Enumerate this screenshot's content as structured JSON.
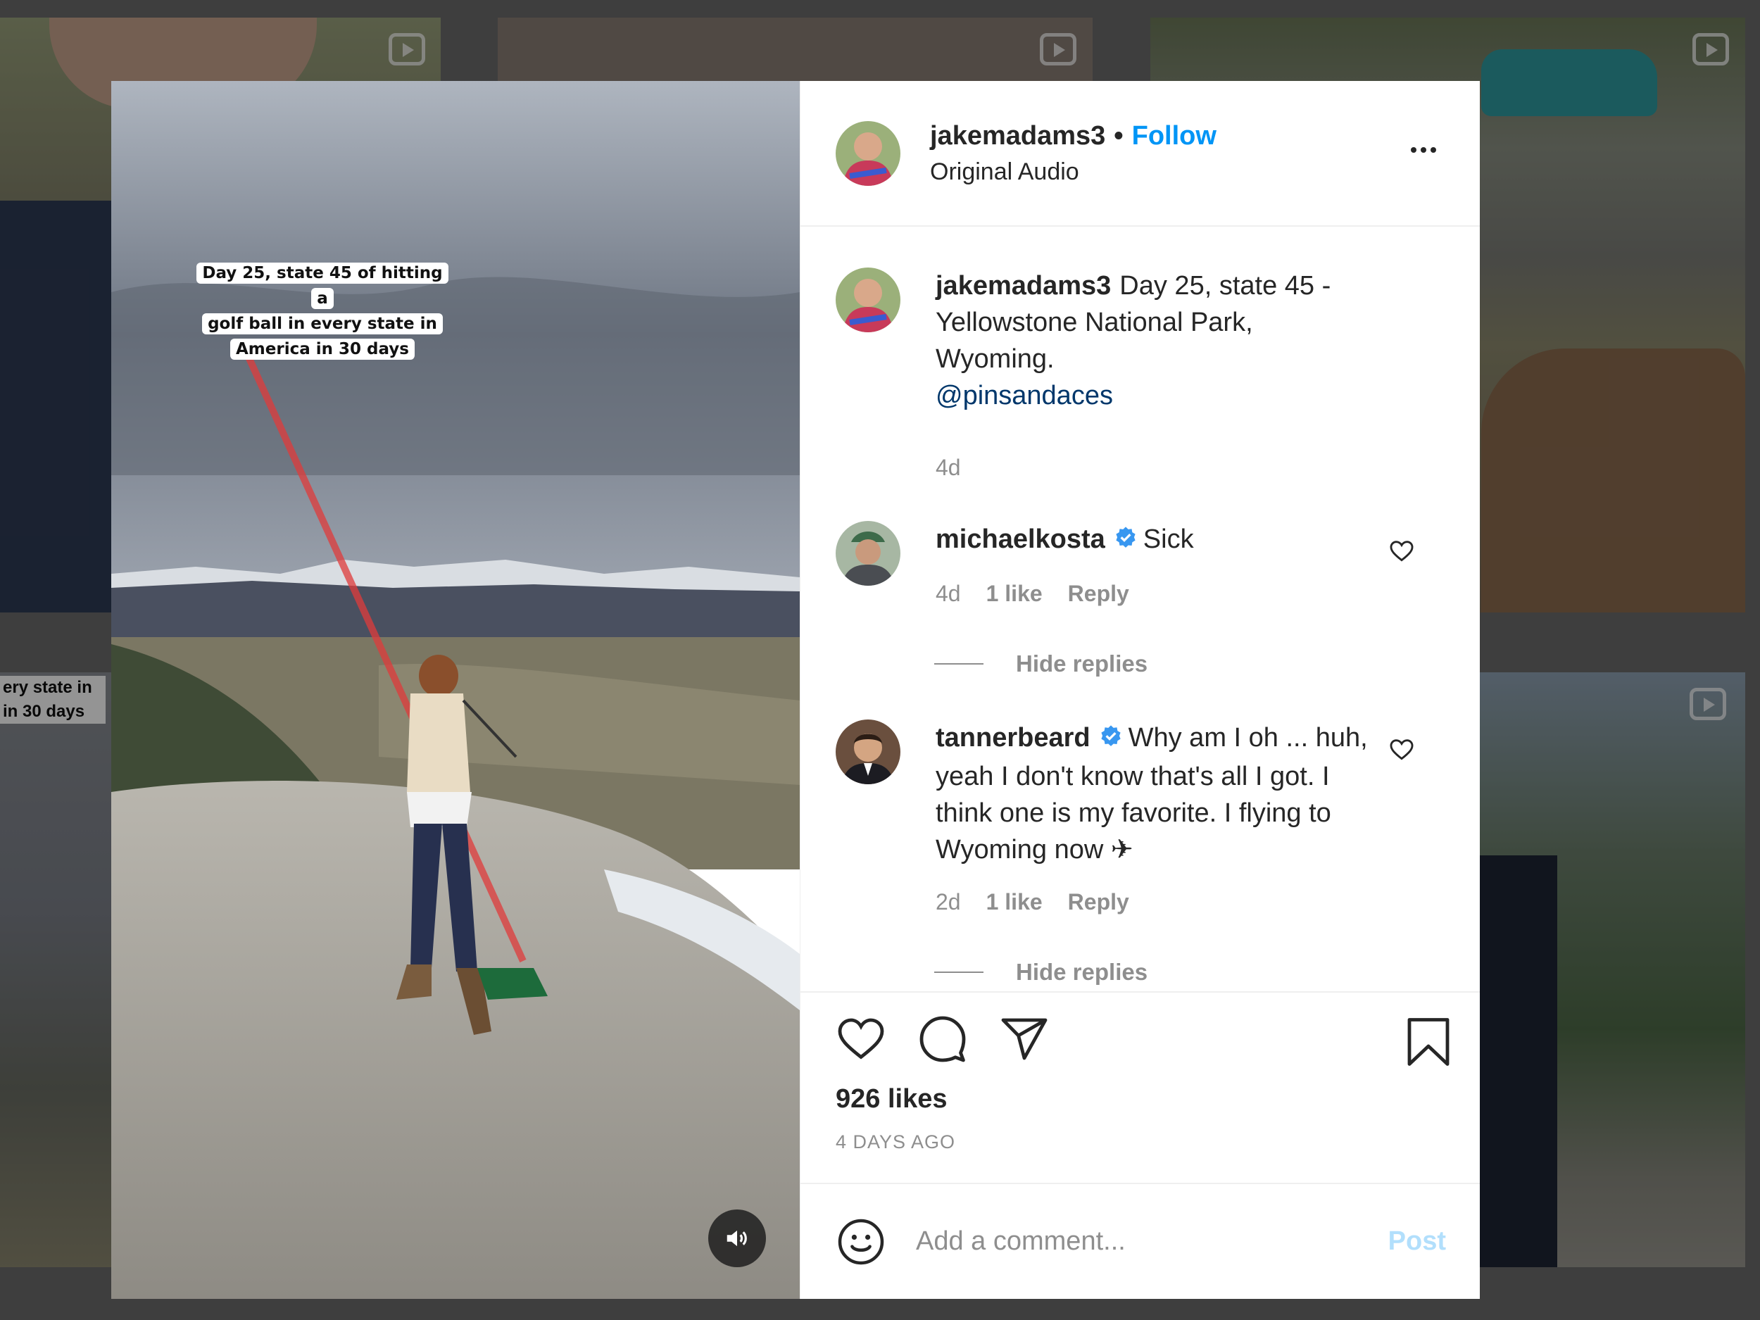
{
  "background": {
    "tiles": [
      {
        "name": "bg-tile-portrait",
        "reel": true
      },
      {
        "name": "bg-tile-room",
        "reel": true
      },
      {
        "name": "bg-tile-car-elk",
        "reel": true
      },
      {
        "name": "bg-tile-golfer",
        "reel": false
      },
      {
        "name": "bg-tile-forest",
        "reel": true
      }
    ],
    "partial_overlay_text": "ery state in\nin 30 days"
  },
  "media": {
    "overlay_caption": [
      "Day 25, state 45 of hitting a",
      "golf ball in every state in",
      "America in 30 days"
    ],
    "sound_icon": "speaker-icon"
  },
  "header": {
    "username": "jakemadams3",
    "separator": "•",
    "follow_label": "Follow",
    "audio_label": "Original Audio",
    "more_icon": "more-options-icon"
  },
  "caption": {
    "username": "jakemadams3",
    "text_before_mention": "Day 25, state 45 - Yellowstone National Park, Wyoming.",
    "mention": "@pinsandaces",
    "age": "4d"
  },
  "comments": [
    {
      "username": "michaelkosta",
      "verified": true,
      "text": "Sick",
      "age": "4d",
      "likes": "1 like",
      "reply_label": "Reply",
      "hide_replies_label": "Hide replies"
    },
    {
      "username": "tannerbeard",
      "verified": true,
      "text": "Why am I oh ... huh, yeah I don't know that's all I got. I think one is my favorite. I flying to Wyoming now ✈",
      "age": "2d",
      "likes": "1 like",
      "reply_label": "Reply",
      "hide_replies_label": "Hide replies"
    }
  ],
  "actions": {
    "icons": [
      "heart-icon",
      "comment-icon",
      "share-icon",
      "bookmark-icon"
    ],
    "likes_text": "926 likes",
    "timestamp": "4 DAYS AGO"
  },
  "add_comment": {
    "placeholder": "Add a comment...",
    "post_label": "Post",
    "emoji_icon": "emoji-icon"
  },
  "colors": {
    "follow": "#0095f6",
    "mention": "#00376b",
    "muted": "#8e8e8e",
    "post_disabled": "#b2dffc",
    "verified": "#3897f0"
  }
}
